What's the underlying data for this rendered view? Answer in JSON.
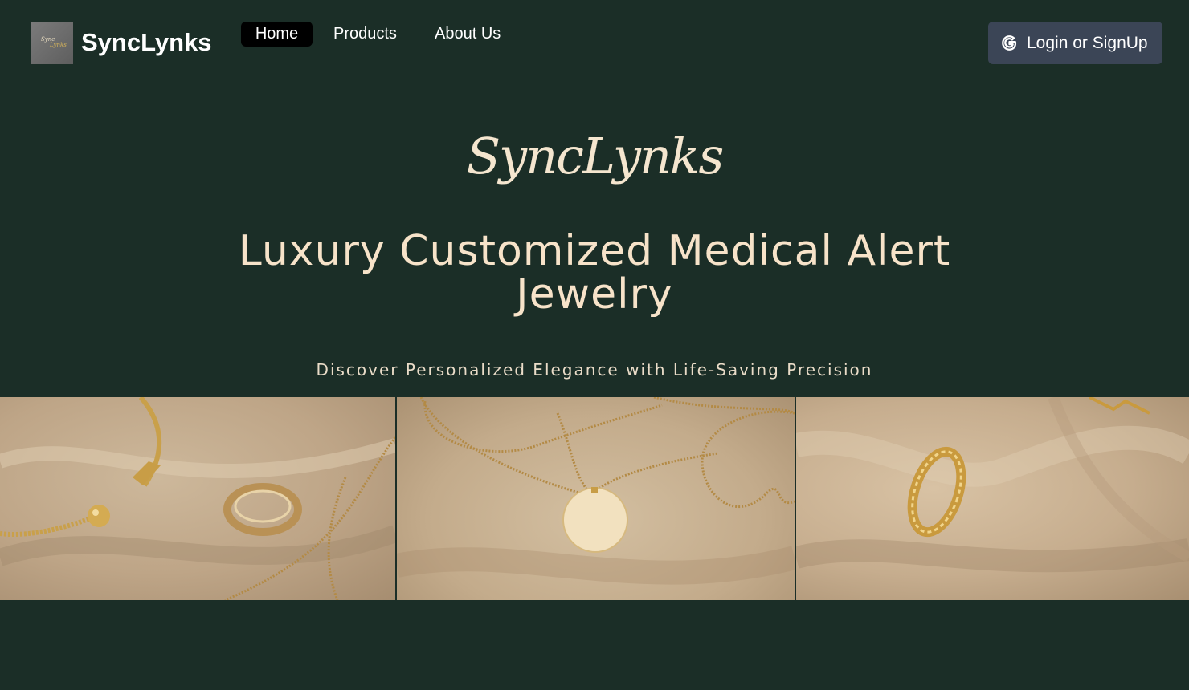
{
  "nav": {
    "brand": "SyncLynks",
    "logo_text_top": "Sync",
    "logo_text_bottom": "Lynks",
    "links": [
      {
        "label": "Home",
        "active": true
      },
      {
        "label": "Products",
        "active": false
      },
      {
        "label": "About Us",
        "active": false
      }
    ],
    "login_label": "Login or SignUp",
    "login_icon": "google-g-icon"
  },
  "hero": {
    "script_logo": "SyncLynks",
    "title": "Luxury Customized Medical Alert Jewelry",
    "subtitle": "Discover Personalized Elegance with Life-Saving Precision"
  },
  "gallery": [
    {
      "name": "bracelet-and-ring-photo"
    },
    {
      "name": "pendant-necklace-photo"
    },
    {
      "name": "gold-ring-on-fabric-photo"
    }
  ],
  "colors": {
    "background": "#1b2e27",
    "hero_text": "#f7e3c9",
    "login_button": "#3b4556",
    "active_nav": "#000000"
  }
}
